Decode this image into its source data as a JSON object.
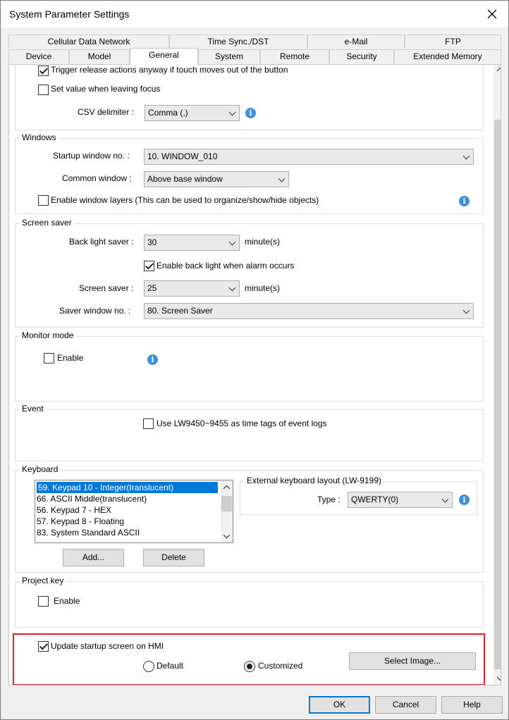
{
  "window": {
    "title": "System Parameter Settings"
  },
  "tabs_row1": [
    "Cellular Data Network",
    "Time Sync./DST",
    "e-Mail",
    "FTP"
  ],
  "tabs_row2": [
    "Device",
    "Model",
    "General",
    "System",
    "Remote",
    "Security",
    "Extended Memory"
  ],
  "active_tab": "General",
  "top": {
    "trigger_release": {
      "label": "Trigger release actions anyway if touch moves out of the button",
      "checked": true
    },
    "set_value_leaving_focus": {
      "label": "Set value when leaving focus",
      "checked": false
    },
    "csv_delimiter": {
      "label": "CSV delimiter :",
      "value": "Comma (,)"
    }
  },
  "windows": {
    "title": "Windows",
    "startup_label": "Startup window no. :",
    "startup_value": "10. WINDOW_010",
    "common_label": "Common window :",
    "common_value": "Above base window",
    "layers_label": "Enable window layers (This can be used to organize/show/hide objects)",
    "layers_checked": false
  },
  "screen_saver": {
    "title": "Screen saver",
    "backlight_label": "Back light saver :",
    "backlight_value": "30",
    "backlight_unit": "minute(s)",
    "alarm_label": "Enable back light when alarm occurs",
    "alarm_checked": true,
    "saver_label": "Screen saver :",
    "saver_value": "25",
    "saver_unit": "minute(s)",
    "saver_window_label": "Saver window no. :",
    "saver_window_value": "80. Screen Saver"
  },
  "monitor_mode": {
    "title": "Monitor mode",
    "enable_label": "Enable",
    "enabled": false
  },
  "event": {
    "title": "Event",
    "lw_label": "Use LW9450~9455 as time tags of event logs",
    "checked": false
  },
  "keyboard": {
    "title": "Keyboard",
    "items": [
      "59. Keypad 10 - Integer(translucent)",
      "66. ASCII Middle(translucent)",
      "56. Keypad 7 - HEX",
      "57. Keypad 8 - Floating",
      "83. System Standard ASCII"
    ],
    "selected_index": 0,
    "add_label": "Add...",
    "delete_label": "Delete",
    "external_title": "External keyboard layout (LW-9199)",
    "type_label": "Type :",
    "type_value": "QWERTY(0)"
  },
  "project_key": {
    "title": "Project key",
    "enable_label": "Enable",
    "enabled": false
  },
  "startup_screen": {
    "update_label": "Update startup screen on HMI",
    "update_checked": true,
    "default_label": "Default",
    "customized_label": "Customized",
    "selected": "Customized",
    "select_image_label": "Select Image..."
  },
  "footer": {
    "ok": "OK",
    "cancel": "Cancel",
    "help": "Help"
  },
  "colors": {
    "accent": "#0078d7",
    "highlight_border": "#e0202c",
    "info": "#3e8ede"
  }
}
